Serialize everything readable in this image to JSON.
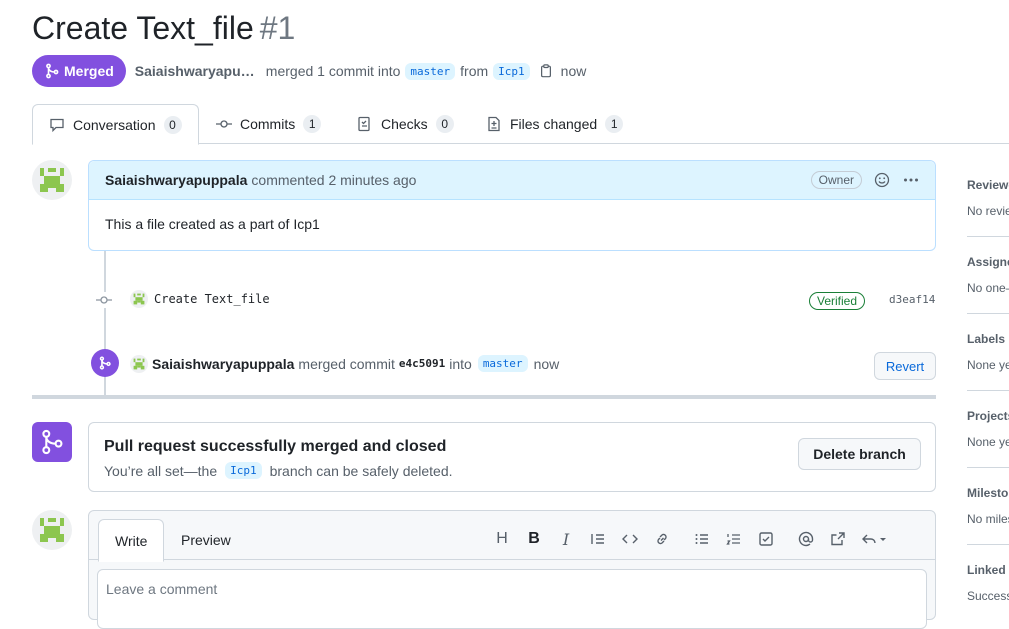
{
  "title": {
    "text": "Create Text_file",
    "number": "#1"
  },
  "status": {
    "badge": "Merged",
    "author": "Saiaishwaryapup...",
    "action": "merged 1 commit into",
    "base_branch": "master",
    "from": "from",
    "head_branch": "Icp1",
    "time": "now"
  },
  "tabs": [
    {
      "label": "Conversation",
      "count": "0"
    },
    {
      "label": "Commits",
      "count": "1"
    },
    {
      "label": "Checks",
      "count": "0"
    },
    {
      "label": "Files changed",
      "count": "1"
    }
  ],
  "comment": {
    "author": "Saiaishwaryapuppala",
    "meta": "commented 2 minutes ago",
    "role": "Owner",
    "body": "This a file created as a part of Icp1"
  },
  "commit": {
    "message": "Create Text_file",
    "verified": "Verified",
    "sha": "d3eaf14"
  },
  "merge_event": {
    "author": "Saiaishwaryapuppala",
    "text": "merged commit",
    "sha": "e4c5091",
    "into": "into",
    "branch": "master",
    "time": "now",
    "revert": "Revert"
  },
  "merge_box": {
    "title": "Pull request successfully merged and closed",
    "desc_before": "You’re all set—the",
    "branch": "Icp1",
    "desc_after": "branch can be safely deleted.",
    "button": "Delete branch"
  },
  "editor": {
    "tabs": [
      "Write",
      "Preview"
    ],
    "placeholder": "Leave a comment"
  },
  "sidebar": [
    {
      "heading": "Reviewers",
      "value": "No reviewers"
    },
    {
      "heading": "Assignees",
      "value": "No one—"
    },
    {
      "heading": "Labels",
      "value": "None yet"
    },
    {
      "heading": "Projects",
      "value": "None yet"
    },
    {
      "heading": "Milestone",
      "value": "No milestone"
    },
    {
      "heading": "Linked issues",
      "value": "Successfully"
    }
  ],
  "colors": {
    "merged": "#8250df",
    "accent": "#0969da",
    "verified": "#1a7f37"
  }
}
